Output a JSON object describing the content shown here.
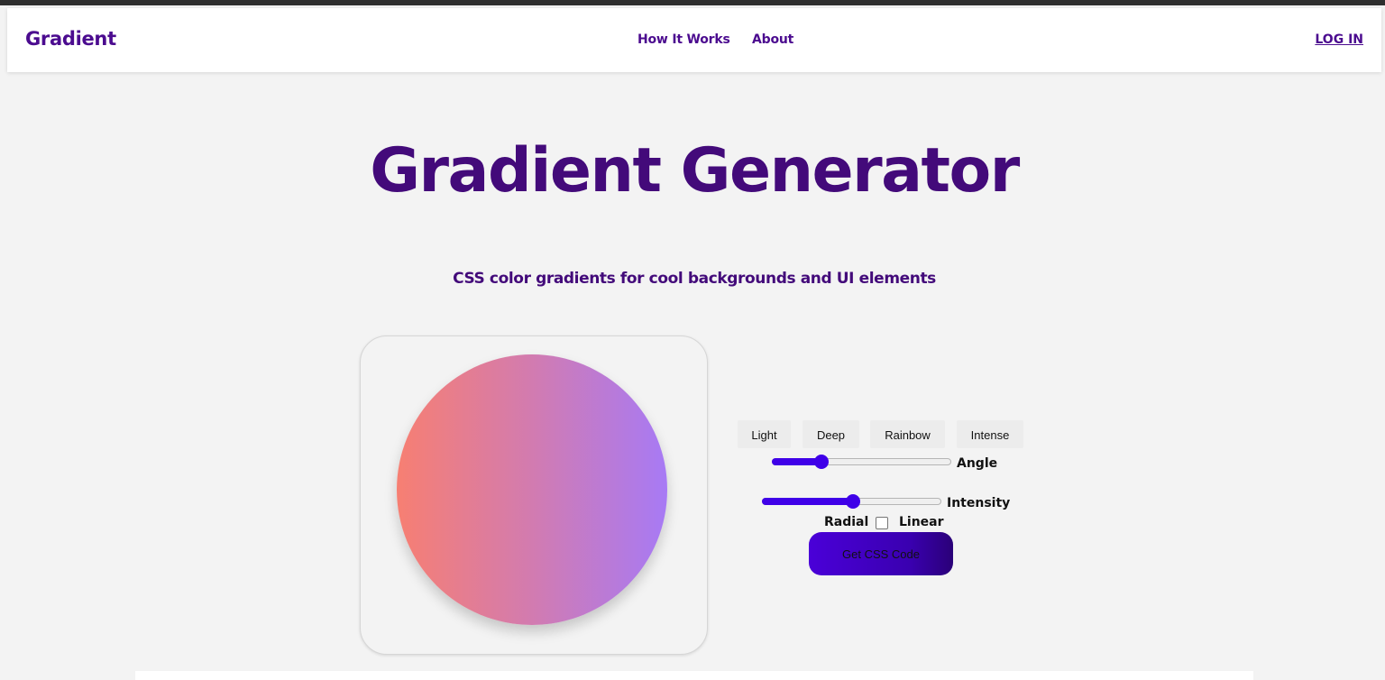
{
  "nav": {
    "brand": "Gradient",
    "links": [
      "How It Works",
      "About"
    ],
    "login": "LOG IN"
  },
  "hero": {
    "title": "Gradient Generator",
    "subtitle": "CSS color gradients for cool backgrounds and UI elements"
  },
  "preview": {
    "gradient_from": "#f77f72",
    "gradient_mid": "#d27bb0",
    "gradient_to": "#a77af5"
  },
  "controls": {
    "presets": [
      "Light",
      "Deep",
      "Rainbow",
      "Intense"
    ],
    "angle_label": "Angle",
    "angle_value_fraction": 0.27,
    "intensity_label": "Intensity",
    "intensity_value_fraction": 0.5,
    "radial_label": "Radial",
    "linear_label": "Linear",
    "linear_checked": false,
    "css_button": "Get CSS Code"
  },
  "colors": {
    "brand_purple": "#4b0b8f",
    "accent_blue": "#3f00e8"
  }
}
